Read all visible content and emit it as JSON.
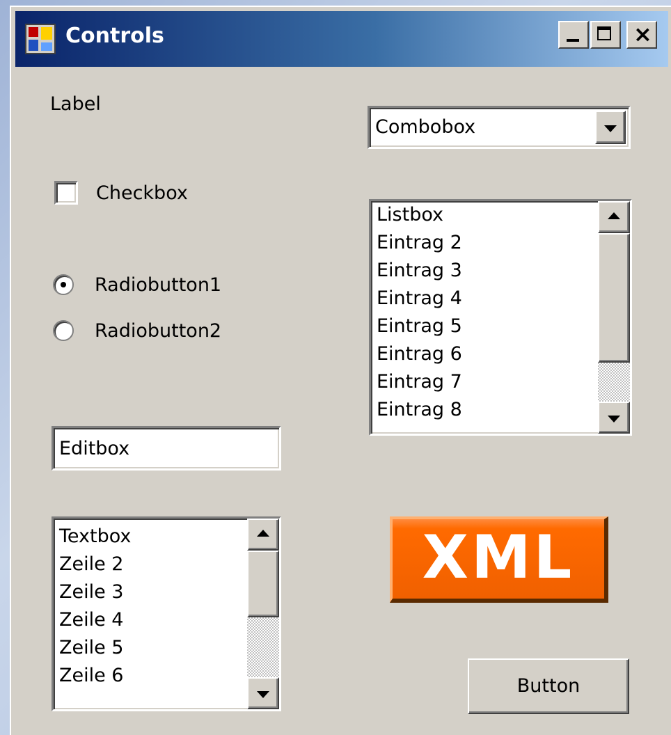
{
  "window": {
    "title": "Controls"
  },
  "controls": {
    "label": "Label",
    "checkbox": {
      "label": "Checkbox",
      "checked": false
    },
    "radios": [
      {
        "label": "Radiobutton1",
        "selected": true
      },
      {
        "label": "Radiobutton2",
        "selected": false
      }
    ],
    "combobox": {
      "value": "Combobox"
    },
    "listbox": {
      "items": [
        "Listbox",
        "Eintrag 2",
        "Eintrag 3",
        "Eintrag 4",
        "Eintrag 5",
        "Eintrag 6",
        "Eintrag 7",
        "Eintrag 8"
      ]
    },
    "editbox": {
      "value": "Editbox"
    },
    "textbox": {
      "lines": [
        "Textbox",
        "Zeile 2",
        "Zeile 3",
        "Zeile 4",
        "Zeile 5",
        "Zeile 6"
      ]
    },
    "logo": {
      "text": "XML",
      "color": "#ff6a00"
    },
    "button": {
      "label": "Button"
    }
  },
  "icons": {
    "app": "app-icon",
    "minimize": "minimize-icon",
    "maximize": "maximize-icon",
    "close": "close-icon"
  }
}
